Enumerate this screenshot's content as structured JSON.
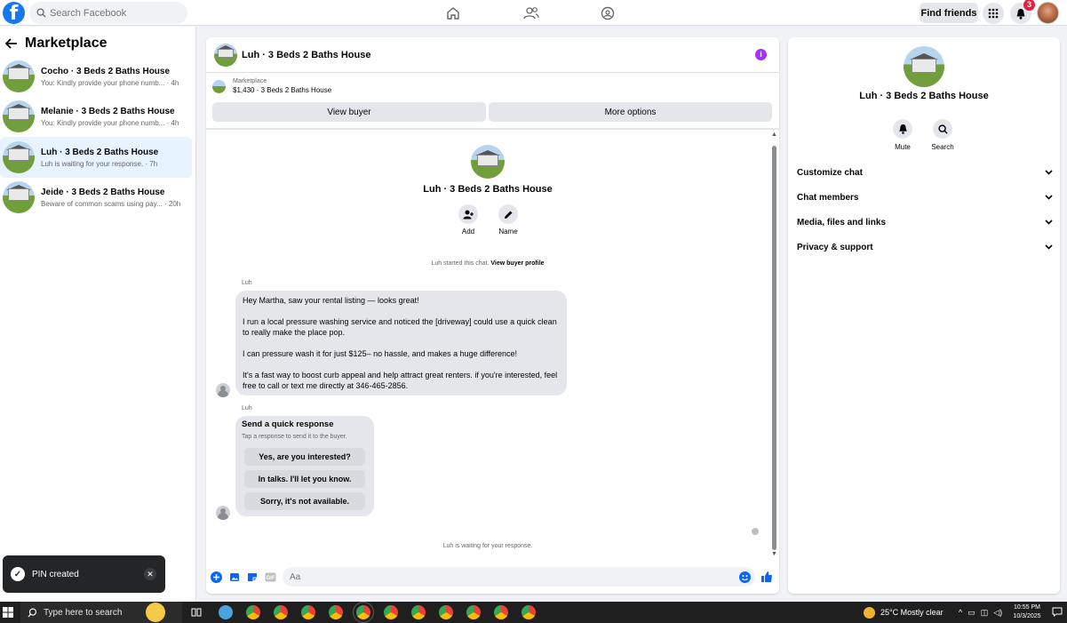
{
  "topbar": {
    "logo": "f",
    "search_placeholder": "Search Facebook",
    "nav_icons": [
      "home-icon",
      "friends-icon",
      "groups-icon"
    ],
    "find_friends": "Find friends",
    "notification_count": "3"
  },
  "sidebar": {
    "title": "Marketplace",
    "conversations": [
      {
        "name": "Cocho · 3 Beds 2 Baths House",
        "preview": "You: Kindly provide your phone numb... · 4h",
        "active": false
      },
      {
        "name": "Melanie · 3 Beds 2 Baths House",
        "preview": "You: Kindly provide your phone numb... · 4h",
        "active": false
      },
      {
        "name": "Luh · 3 Beds 2 Baths House",
        "preview": "Luh is waiting for your response. · 7h",
        "active": true
      },
      {
        "name": "Jeide · 3 Beds 2 Baths House",
        "preview": "Beware of common scams using pay... · 20h",
        "active": false
      }
    ]
  },
  "toast": {
    "text": "PIN created",
    "close": "✕"
  },
  "chat": {
    "title": "Luh · 3 Beds 2 Baths House",
    "listing_label": "Marketplace",
    "listing_detail": "$1,430 · 3 Beds 2 Baths House",
    "view_buyer": "View buyer",
    "more_options": "More options",
    "profile_name": "Luh · 3 Beds 2 Baths House",
    "add_label": "Add",
    "name_label": "Name",
    "started_text": "Luh started this chat.",
    "view_buyer_profile": "View buyer profile",
    "sender": "Luh",
    "message_paragraphs": [
      "Hey Martha, saw your rental listing — looks great!",
      "I run a local pressure washing service and noticed the [driveway] could use a quick clean to really make the place pop.",
      "I can pressure wash it for just $125– no hassle, and makes a huge difference!",
      "It's a fast way to boost curb appeal and help attract great renters. if you're interested, feel free to call or text me directly at 346-465-2856."
    ],
    "quick_response_title": "Send a quick response",
    "quick_response_sub": "Tap a response to send it to the buyer.",
    "quick_responses": [
      "Yes, are you interested?",
      "In talks. I'll let you know.",
      "Sorry, it's not available."
    ],
    "waiting_text": "Luh is waiting for your response.",
    "composer_placeholder": "Aa"
  },
  "right_panel": {
    "title": "Luh · 3 Beds 2 Baths House",
    "mute": "Mute",
    "search": "Search",
    "sections": [
      "Customize chat",
      "Chat members",
      "Media, files and links",
      "Privacy & support"
    ]
  },
  "taskbar": {
    "search_placeholder": "Type here to search",
    "weather": "25°C  Mostly clear",
    "time": "10:55 PM",
    "date": "10/3/2025"
  },
  "colors": {
    "brand": "#1877f2",
    "info": "#a033ff",
    "active_row": "#e7f3ff",
    "badge": "#e41e3f"
  }
}
